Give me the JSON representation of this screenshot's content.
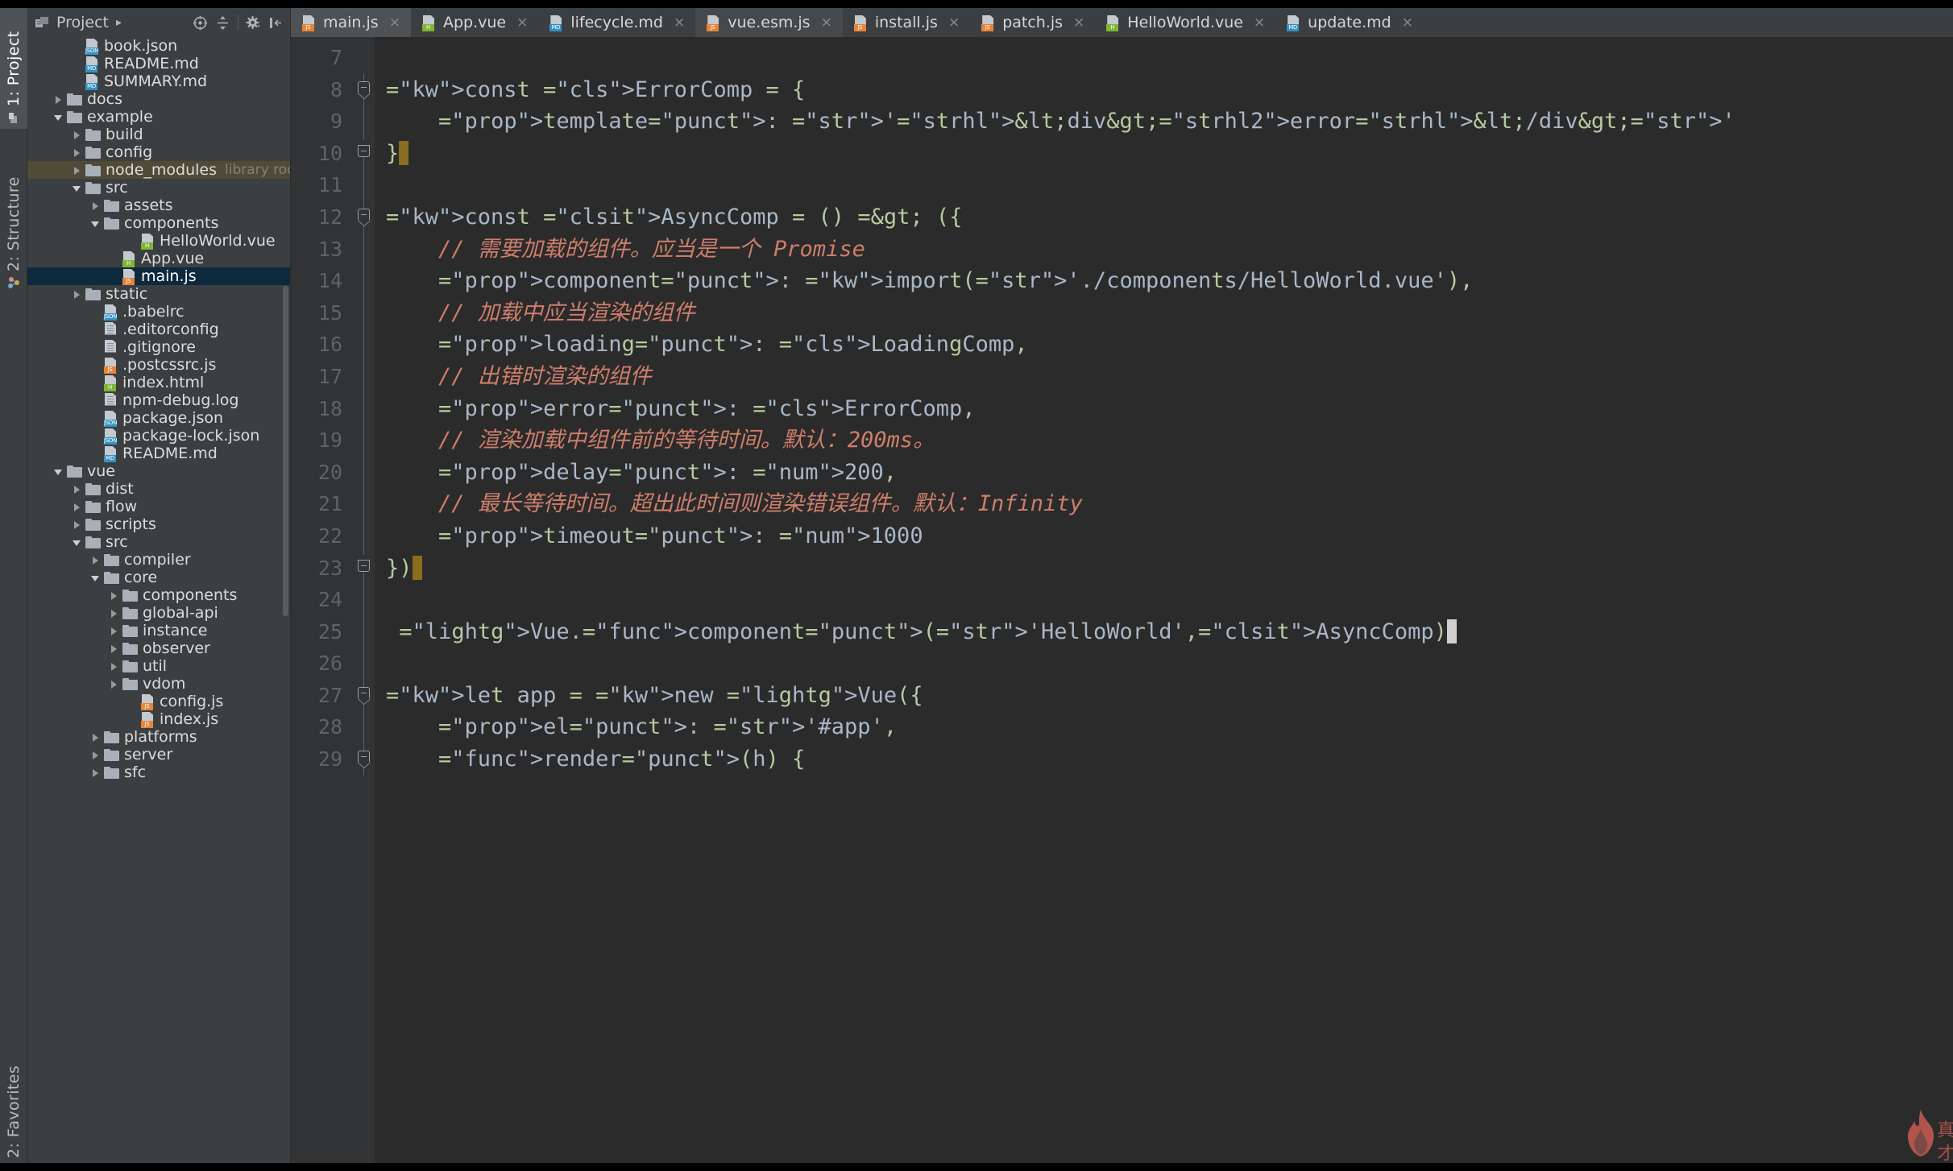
{
  "window": {
    "left_rail": [
      {
        "label": "1: Project",
        "icon": "project-icon",
        "active": true
      },
      {
        "label": "2: Structure",
        "icon": "structure-icon",
        "active": false
      },
      {
        "label": "2: Favorites",
        "icon": "favorites-icon",
        "active": false
      }
    ]
  },
  "project_panel": {
    "title": "Project",
    "expand_caret": "▸",
    "toolbar_icons": [
      "locate-icon",
      "collapse-all-icon",
      "settings-gear-icon",
      "hide-panel-icon"
    ],
    "tree": [
      {
        "indent": 2,
        "kind": "file",
        "badge": "json",
        "label": "book.json",
        "arrow": "none"
      },
      {
        "indent": 2,
        "kind": "file",
        "badge": "md",
        "label": "README.md",
        "arrow": "none"
      },
      {
        "indent": 2,
        "kind": "file",
        "badge": "md",
        "label": "SUMMARY.md",
        "arrow": "none"
      },
      {
        "indent": 1,
        "kind": "folder",
        "label": "docs",
        "arrow": "right"
      },
      {
        "indent": 1,
        "kind": "folder",
        "label": "example",
        "arrow": "down"
      },
      {
        "indent": 2,
        "kind": "folder",
        "label": "build",
        "arrow": "right"
      },
      {
        "indent": 2,
        "kind": "folder",
        "label": "config",
        "arrow": "right"
      },
      {
        "indent": 2,
        "kind": "folder",
        "label": "node_modules",
        "note": "library root",
        "arrow": "right",
        "highlight": true
      },
      {
        "indent": 2,
        "kind": "folder",
        "label": "src",
        "arrow": "down"
      },
      {
        "indent": 3,
        "kind": "folder",
        "label": "assets",
        "arrow": "right"
      },
      {
        "indent": 3,
        "kind": "folder",
        "label": "components",
        "arrow": "down"
      },
      {
        "indent": 5,
        "kind": "file",
        "badge": "h",
        "label": "HelloWorld.vue",
        "arrow": "none"
      },
      {
        "indent": 4,
        "kind": "file",
        "badge": "h",
        "label": "App.vue",
        "arrow": "none"
      },
      {
        "indent": 4,
        "kind": "file",
        "badge": "js",
        "label": "main.js",
        "arrow": "none",
        "selected": true
      },
      {
        "indent": 2,
        "kind": "folder",
        "label": "static",
        "arrow": "right"
      },
      {
        "indent": 3,
        "kind": "file",
        "badge": "json",
        "label": ".babelrc",
        "arrow": "none"
      },
      {
        "indent": 3,
        "kind": "file",
        "badge": "plain",
        "label": ".editorconfig",
        "arrow": "none"
      },
      {
        "indent": 3,
        "kind": "file",
        "badge": "plain",
        "label": ".gitignore",
        "arrow": "none"
      },
      {
        "indent": 3,
        "kind": "file",
        "badge": "js",
        "label": ".postcssrc.js",
        "arrow": "none"
      },
      {
        "indent": 3,
        "kind": "file",
        "badge": "h",
        "label": "index.html",
        "arrow": "none"
      },
      {
        "indent": 3,
        "kind": "file",
        "badge": "plain",
        "label": "npm-debug.log",
        "arrow": "none"
      },
      {
        "indent": 3,
        "kind": "file",
        "badge": "json",
        "label": "package.json",
        "arrow": "none"
      },
      {
        "indent": 3,
        "kind": "file",
        "badge": "json",
        "label": "package-lock.json",
        "arrow": "none"
      },
      {
        "indent": 3,
        "kind": "file",
        "badge": "md",
        "label": "README.md",
        "arrow": "none"
      },
      {
        "indent": 1,
        "kind": "folder",
        "label": "vue",
        "arrow": "down"
      },
      {
        "indent": 2,
        "kind": "folder",
        "label": "dist",
        "arrow": "right"
      },
      {
        "indent": 2,
        "kind": "folder",
        "label": "flow",
        "arrow": "right"
      },
      {
        "indent": 2,
        "kind": "folder",
        "label": "scripts",
        "arrow": "right"
      },
      {
        "indent": 2,
        "kind": "folder",
        "label": "src",
        "arrow": "down"
      },
      {
        "indent": 3,
        "kind": "folder",
        "label": "compiler",
        "arrow": "right"
      },
      {
        "indent": 3,
        "kind": "folder",
        "label": "core",
        "arrow": "down"
      },
      {
        "indent": 4,
        "kind": "folder",
        "label": "components",
        "arrow": "right"
      },
      {
        "indent": 4,
        "kind": "folder",
        "label": "global-api",
        "arrow": "right"
      },
      {
        "indent": 4,
        "kind": "folder",
        "label": "instance",
        "arrow": "right"
      },
      {
        "indent": 4,
        "kind": "folder",
        "label": "observer",
        "arrow": "right"
      },
      {
        "indent": 4,
        "kind": "folder",
        "label": "util",
        "arrow": "right"
      },
      {
        "indent": 4,
        "kind": "folder",
        "label": "vdom",
        "arrow": "right"
      },
      {
        "indent": 5,
        "kind": "file",
        "badge": "js",
        "label": "config.js",
        "arrow": "none"
      },
      {
        "indent": 5,
        "kind": "file",
        "badge": "js",
        "label": "index.js",
        "arrow": "none"
      },
      {
        "indent": 3,
        "kind": "folder",
        "label": "platforms",
        "arrow": "right"
      },
      {
        "indent": 3,
        "kind": "folder",
        "label": "server",
        "arrow": "right"
      },
      {
        "indent": 3,
        "kind": "folder",
        "label": "sfc",
        "arrow": "right"
      }
    ]
  },
  "editor": {
    "tabs": [
      {
        "label": "main.js",
        "badge": "js",
        "active": true,
        "close": "×"
      },
      {
        "label": "App.vue",
        "badge": "h",
        "active": false,
        "close": "×"
      },
      {
        "label": "lifecycle.md",
        "badge": "md",
        "active": false,
        "close": "×"
      },
      {
        "label": "vue.esm.js",
        "badge": "jslib",
        "active": false,
        "close": "×",
        "hover": true
      },
      {
        "label": "install.js",
        "badge": "js",
        "active": false,
        "close": "×"
      },
      {
        "label": "patch.js",
        "badge": "js",
        "active": false,
        "close": "×"
      },
      {
        "label": "HelloWorld.vue",
        "badge": "h",
        "active": false,
        "close": "×"
      },
      {
        "label": "update.md",
        "badge": "md",
        "active": false,
        "close": "×"
      }
    ],
    "line_numbers": [
      7,
      8,
      9,
      10,
      11,
      12,
      13,
      14,
      15,
      16,
      17,
      18,
      19,
      20,
      21,
      22,
      23,
      24,
      25,
      26,
      27,
      28,
      29
    ],
    "code": [
      "",
      "const ErrorComp = {",
      "    template: '<div>error</div>'",
      "}",
      "",
      "const AsyncComp = () => ({",
      "    // 需要加载的组件。应当是一个 Promise",
      "    component: import('./components/HelloWorld.vue'),",
      "    // 加载中应当渲染的组件",
      "    loading: LoadingComp,",
      "    // 出错时渲染的组件",
      "    error: ErrorComp,",
      "    // 渲染加载中组件前的等待时间。默认：200ms。",
      "    delay: 200,",
      "    // 最长等待时间。超出此时间则渲染错误组件。默认：Infinity",
      "    timeout: 1000",
      "})",
      "",
      " Vue.component('HelloWorld',AsyncComp)",
      "",
      "let app = new Vue({",
      "    el: '#app',",
      "    render(h) {"
    ],
    "watermark_text": "真\n才"
  },
  "colors": {
    "background": "#2b2b2b",
    "panel": "#3c3f41",
    "gutter": "#313335",
    "selection": "#0d293e",
    "highlight_row": "#4f4b36",
    "keyword": "#cc7832",
    "string": "#6a8759",
    "comment": "#cf7e6b",
    "number": "#f07cbb",
    "class": "#8aa5e0",
    "search_highlight": "#345635",
    "accent_js": "#e8833a",
    "accent_json": "#3592c4",
    "accent_vue": "#7fb537"
  }
}
